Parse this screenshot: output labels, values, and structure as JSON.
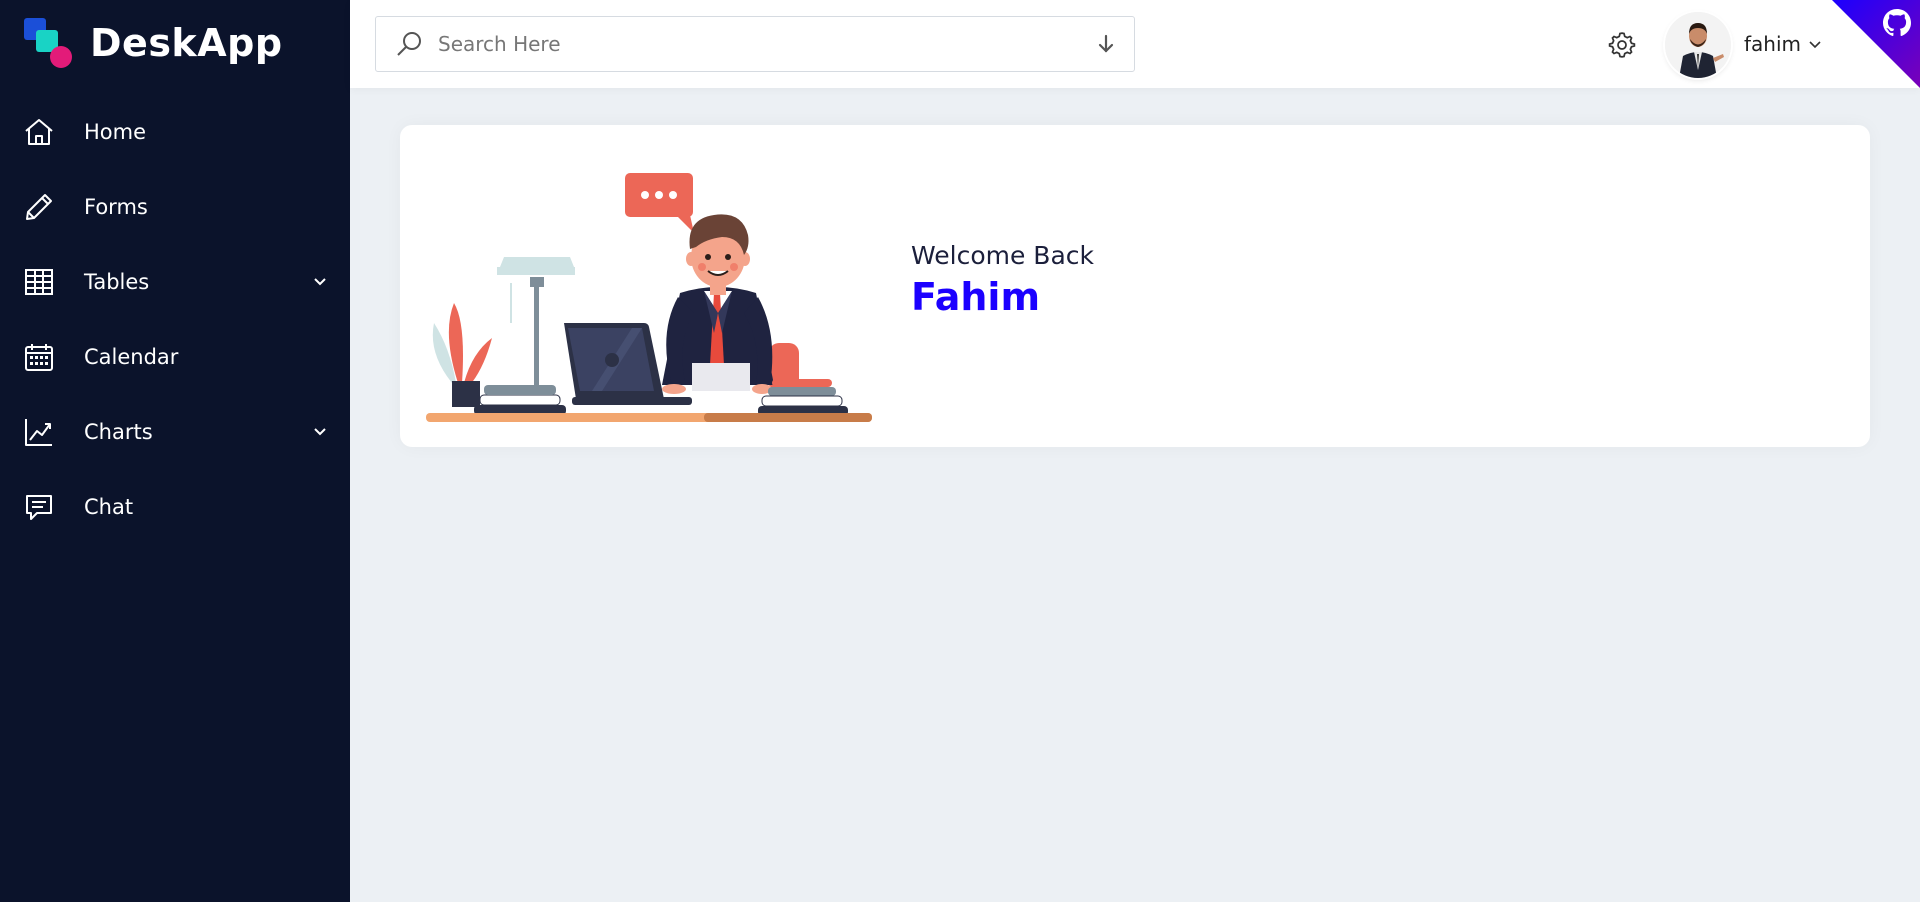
{
  "brand": {
    "name": "DeskApp"
  },
  "nav": {
    "items": [
      {
        "label": "Home",
        "icon": "home-icon"
      },
      {
        "label": "Forms",
        "icon": "pencil-icon"
      },
      {
        "label": "Tables",
        "icon": "table-icon",
        "has_submenu": true
      },
      {
        "label": "Calendar",
        "icon": "calendar-icon"
      },
      {
        "label": "Charts",
        "icon": "chart-line-icon",
        "has_submenu": true
      },
      {
        "label": "Chat",
        "icon": "chat-icon"
      }
    ]
  },
  "header": {
    "search_placeholder": "Search Here",
    "username": "fahim"
  },
  "welcome": {
    "greeting": "Welcome Back",
    "name": "Fahim"
  },
  "colors": {
    "sidebar_bg": "#0b132b",
    "accent": "#1b00ff",
    "page_bg": "#ecf0f4"
  }
}
